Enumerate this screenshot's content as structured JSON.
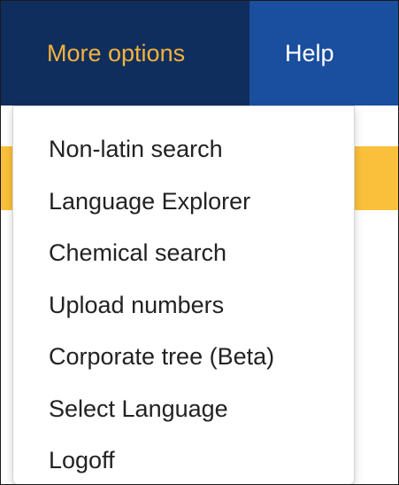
{
  "navbar": {
    "more_options": "More options",
    "help": "Help"
  },
  "menu": {
    "items": [
      {
        "label": "Non-latin search"
      },
      {
        "label": "Language Explorer"
      },
      {
        "label": "Chemical search"
      },
      {
        "label": "Upload numbers"
      },
      {
        "label": "Corporate tree (Beta)"
      },
      {
        "label": "Select Language"
      },
      {
        "label": "Logoff"
      }
    ]
  },
  "colors": {
    "navbar_bg": "#1a4e9e",
    "active_nav_bg": "#0f2e5d",
    "active_nav_text": "#f5b23b",
    "accent_band": "#fbc03b"
  }
}
